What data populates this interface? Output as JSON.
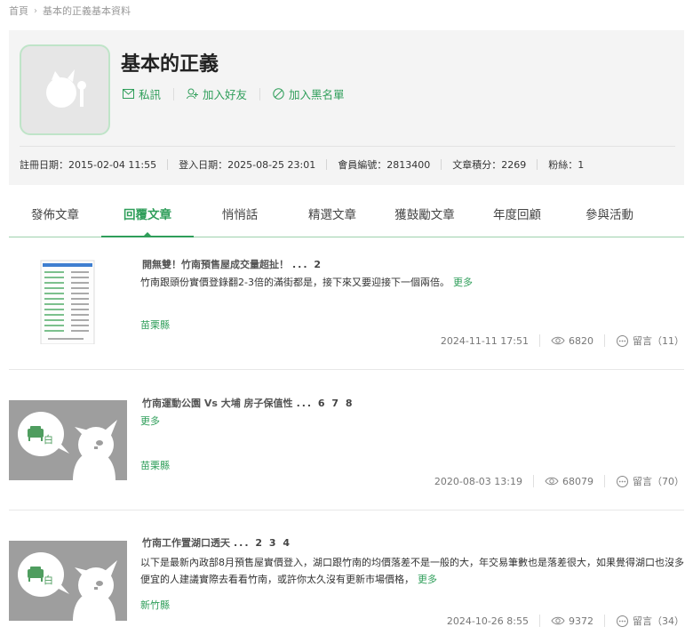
{
  "breadcrumb": {
    "home": "首頁",
    "current": "基本的正義基本資料"
  },
  "profile": {
    "name": "基本的正義",
    "actions": {
      "message": "私訊",
      "add_friend": "加入好友",
      "blacklist": "加入黑名單"
    },
    "stats": {
      "register": "註冊日期：2015-02-04 11:55",
      "login": "登入日期：2025-08-25 23:01",
      "member_no": "會員編號：2813400",
      "points": "文章積分：2269",
      "fans": "粉絲：1"
    }
  },
  "tabs": [
    "發佈文章",
    "回覆文章",
    "悄悄話",
    "精選文章",
    "獲鼓勵文章",
    "年度回顧",
    "參與活動"
  ],
  "active_tab": 1,
  "colors": {
    "accent": "#2f9e5a",
    "thumb_bg": "#9e9e9e"
  },
  "posts": [
    {
      "title": "開無雙！竹南預售屋成交量超扯！",
      "pages": "... 2",
      "text": "竹南跟頭份實價登錄翻2-3倍的滿街都是，接下來又要迎接下一個兩倍。",
      "more": "更多",
      "location": "苗栗縣",
      "date": "2024-11-11 17:51",
      "views": "6820",
      "comments": "留言（11）",
      "thumb": "screenshot-thumbnail"
    },
    {
      "title": "竹南運動公園 Vs 大埔 房子保值性",
      "pages": "... 6 7 8",
      "text": "",
      "more": "更多",
      "location": "苗栗縣",
      "date": "2020-08-03 13:19",
      "views": "68079",
      "comments": "留言（70）",
      "thumb": "default-house-thumbnail"
    },
    {
      "title": "竹南工作置湖口透天",
      "pages": "... 2 3 4",
      "text": "以下是最新內政部8月預售屋實價登入，湖口跟竹南的均價落差不是一般的大，年交易筆數也是落差很大，如果覺得湖口也沒多便宜的人建議實際去看看竹南，或許你太久沒有更新市場價格，",
      "more": "更多",
      "location": "新竹縣",
      "date": "2024-10-26 8:55",
      "views": "9372",
      "comments": "留言（34）",
      "thumb": "default-house-thumbnail"
    }
  ]
}
